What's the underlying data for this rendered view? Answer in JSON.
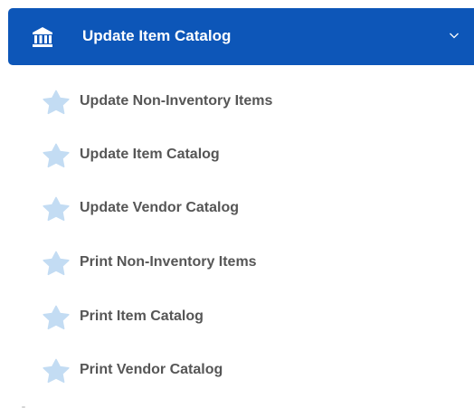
{
  "header": {
    "title": "Update Item Catalog",
    "icon": "bank-icon",
    "background_color": "#0d56b8",
    "expanded": true
  },
  "items": [
    {
      "label": "Update Non-Inventory Items",
      "icon": "star-icon"
    },
    {
      "label": "Update Item Catalog",
      "icon": "star-icon"
    },
    {
      "label": "Update Vendor Catalog",
      "icon": "star-icon"
    },
    {
      "label": "Print Non-Inventory Items",
      "icon": "star-icon"
    },
    {
      "label": "Print Item Catalog",
      "icon": "star-icon"
    },
    {
      "label": "Print Vendor Catalog",
      "icon": "star-icon"
    }
  ],
  "colors": {
    "accent": "#0d56b8",
    "star": "#c3dcf3",
    "item_text": "#565656"
  }
}
